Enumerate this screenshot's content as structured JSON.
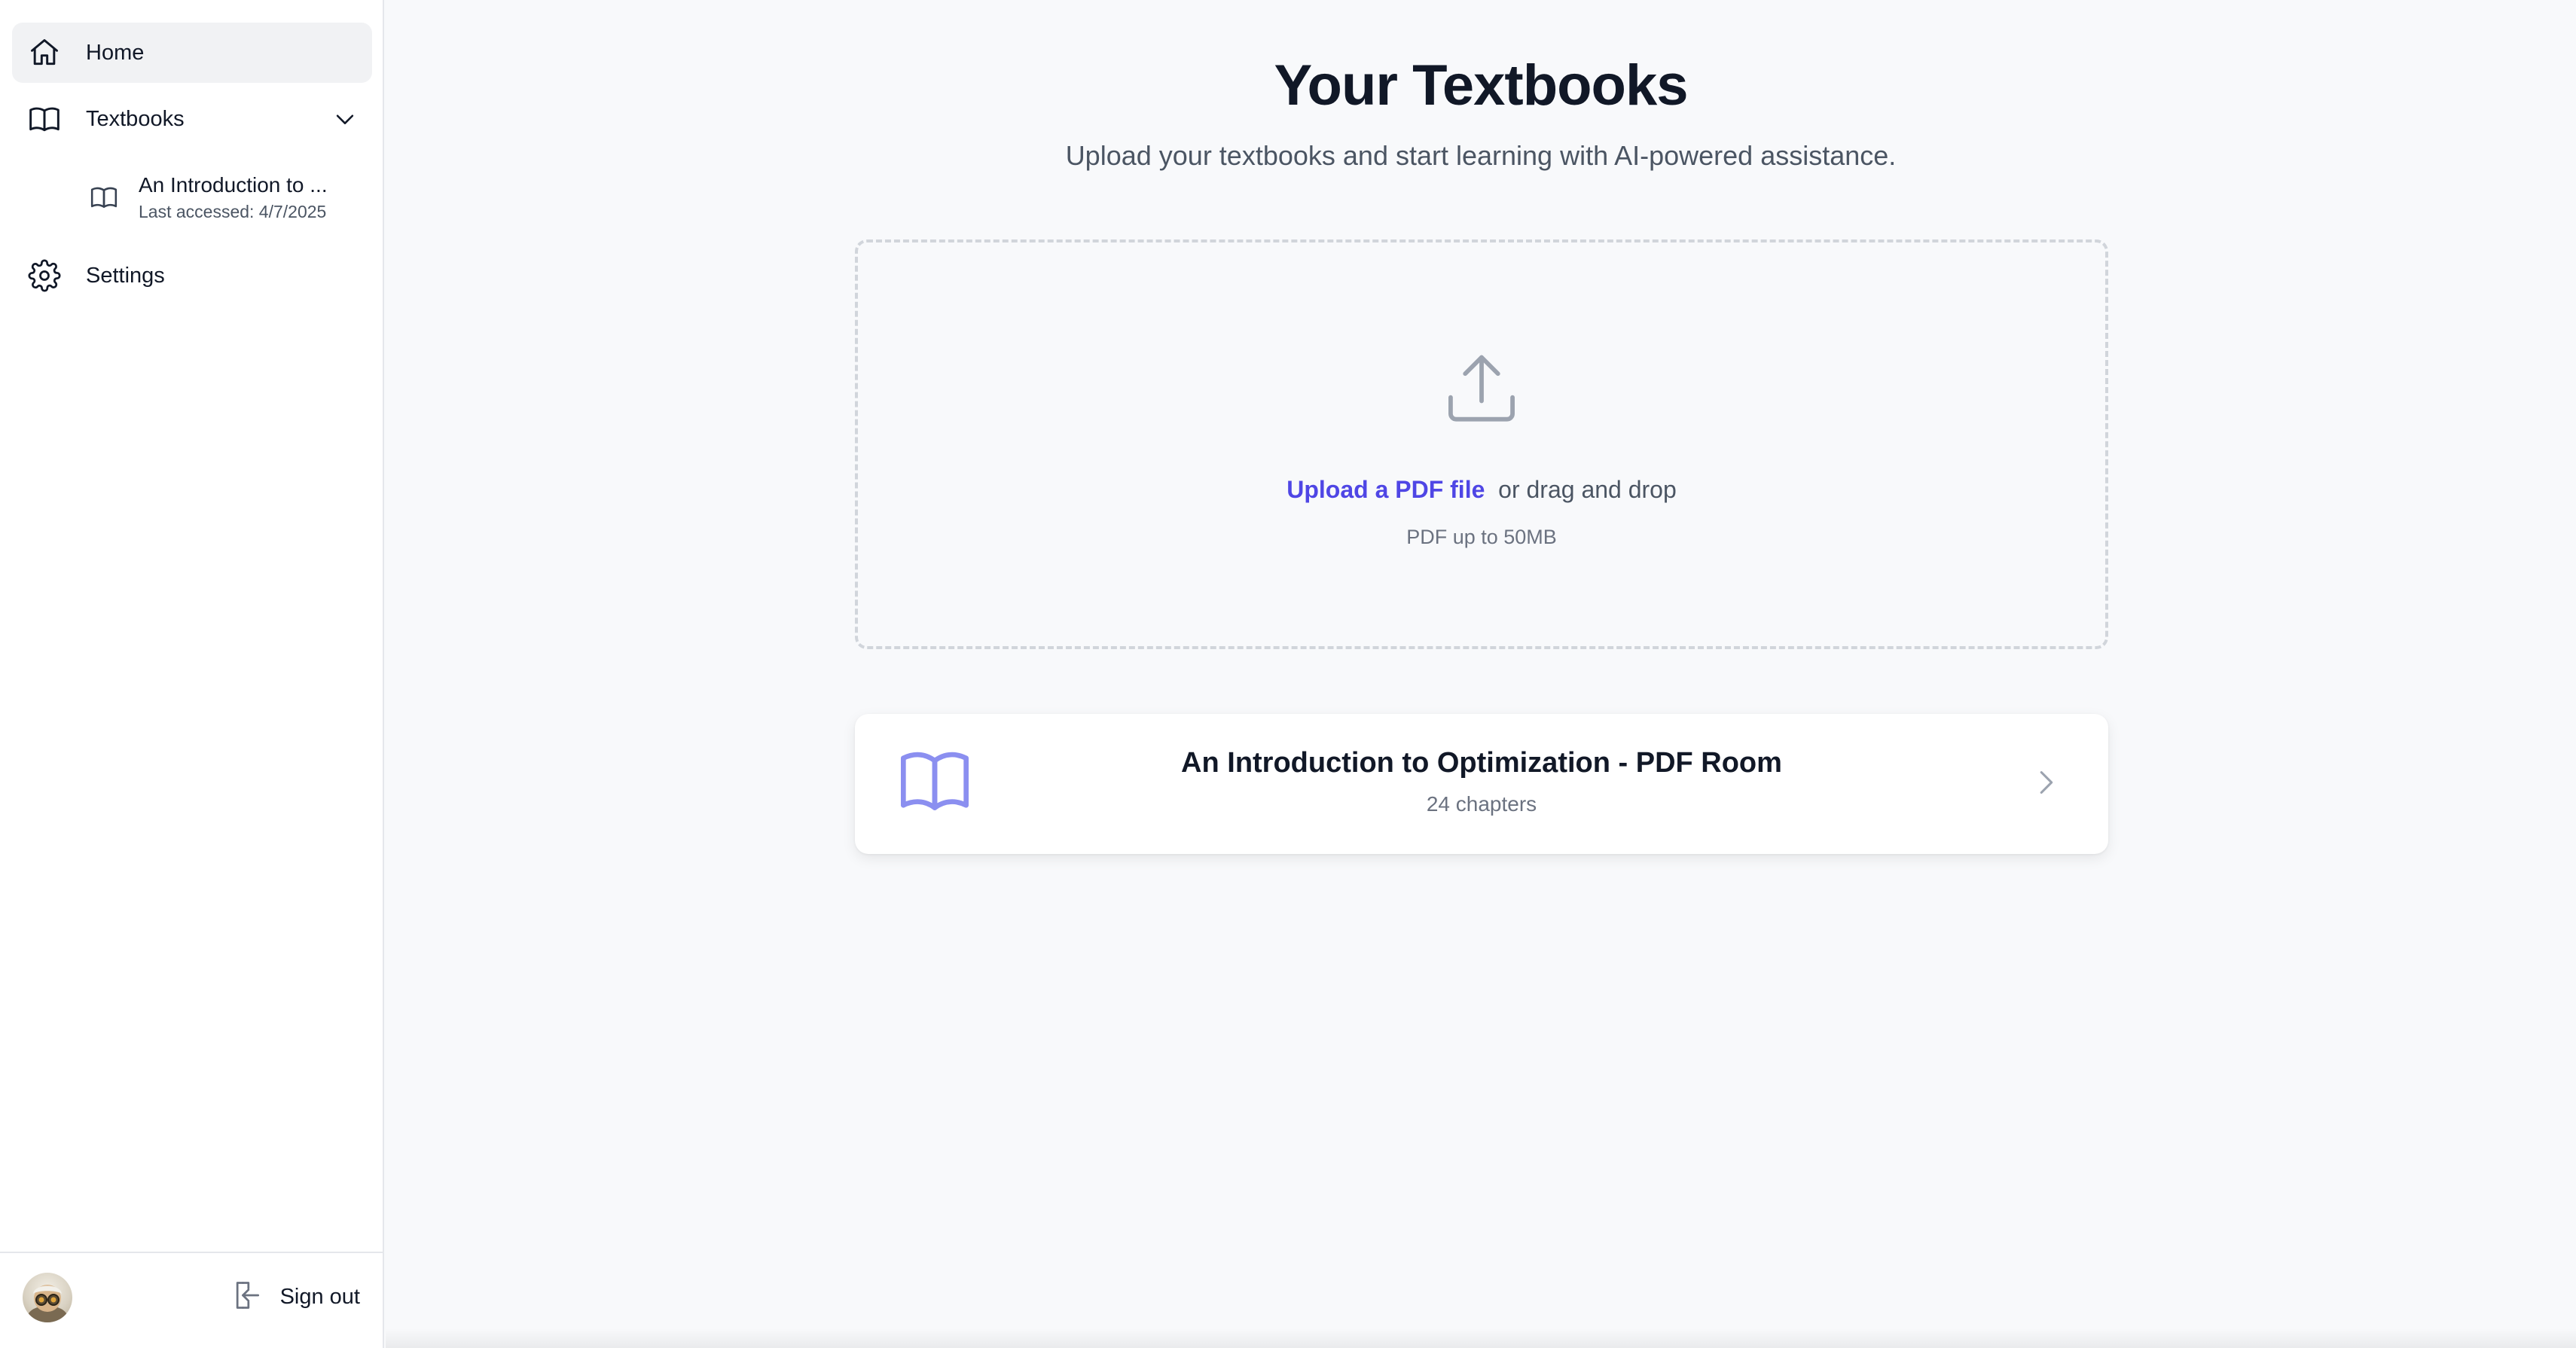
{
  "sidebar": {
    "home": {
      "label": "Home",
      "icon": "home-icon"
    },
    "textbooks": {
      "label": "Textbooks",
      "icon": "book-icon",
      "expanded": true
    },
    "textbook_items": [
      {
        "title": "An Introduction to ...",
        "meta": "Last accessed: 4/7/2025",
        "icon": "book-icon"
      }
    ],
    "settings": {
      "label": "Settings",
      "icon": "gear-icon"
    },
    "footer": {
      "signout_label": "Sign out",
      "signout_icon": "sign-out-icon"
    }
  },
  "main": {
    "title": "Your Textbooks",
    "subtitle": "Upload your textbooks and start learning with AI-powered assistance.",
    "dropzone": {
      "icon": "upload-icon",
      "link_label": "Upload a PDF file",
      "suffix": "or drag and drop",
      "hint": "PDF up to 50MB"
    },
    "books": [
      {
        "title": "An Introduction to Optimization - PDF Room",
        "chapters": "24 chapters",
        "icon": "open-book-icon"
      }
    ]
  },
  "colors": {
    "accent": "#4f46e5",
    "book_icon": "#8b8ff0",
    "text_primary": "#111827",
    "text_secondary": "#4b5563"
  }
}
